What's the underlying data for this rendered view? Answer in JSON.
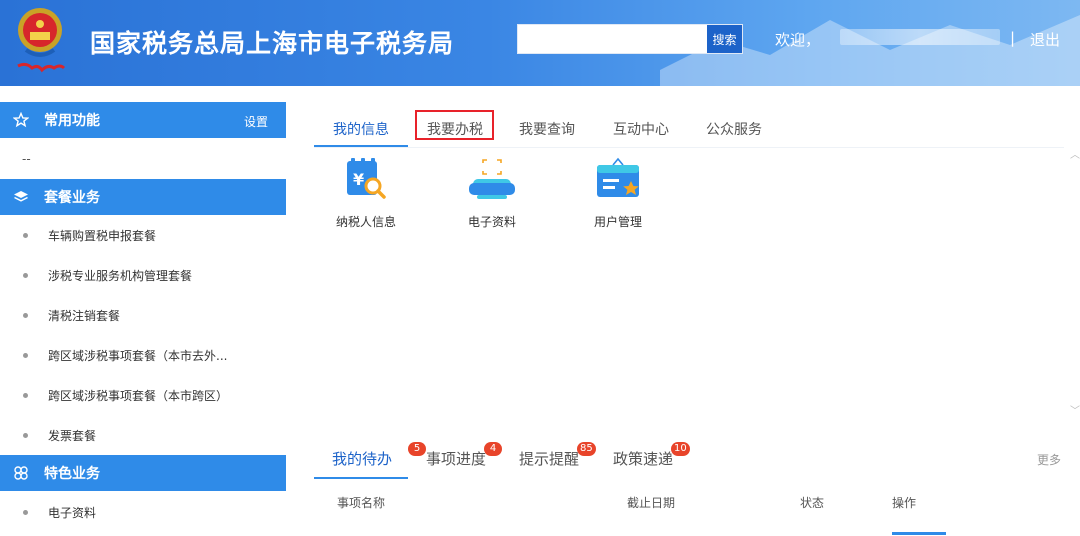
{
  "header": {
    "title": "国家税务总局上海市电子税务局",
    "search": {
      "value": "",
      "button_label": "搜索"
    },
    "welcome": "欢迎，",
    "separator": "|",
    "logout": "退出"
  },
  "sidebar": {
    "sections": [
      {
        "title": "常用功能",
        "icon": "star-icon",
        "action": "设置",
        "items": [],
        "placeholder": "--"
      },
      {
        "title": "套餐业务",
        "icon": "layers-icon",
        "items": [
          "车辆购置税申报套餐",
          "涉税专业服务机构管理套餐",
          "清税注销套餐",
          "跨区域涉税事项套餐（本市去外...",
          "跨区域涉税事项套餐（本市跨区）",
          "发票套餐"
        ]
      },
      {
        "title": "特色业务",
        "icon": "grid-flower-icon",
        "items": [
          "电子资料"
        ]
      }
    ]
  },
  "main": {
    "tabs": [
      "我的信息",
      "我要办税",
      "我要查询",
      "互动中心",
      "公众服务"
    ],
    "active_tab": "我的信息",
    "highlighted_tab": "我要办税",
    "apps": [
      {
        "label": "纳税人信息",
        "icon": "taxpayer-info-icon"
      },
      {
        "label": "电子资料",
        "icon": "electronic-docs-icon"
      },
      {
        "label": "用户管理",
        "icon": "user-management-icon"
      }
    ],
    "todo_tabs": [
      {
        "label": "我的待办",
        "badge": "5"
      },
      {
        "label": "事项进度",
        "badge": "4"
      },
      {
        "label": "提示提醒",
        "badge": "85"
      },
      {
        "label": "政策速递",
        "badge": "10"
      }
    ],
    "more": "更多",
    "table_columns": [
      "事项名称",
      "截止日期",
      "状态",
      "操作"
    ]
  },
  "colors": {
    "header_blue": "#2a72d6",
    "accent": "#2f8be8",
    "highlight_border": "#e8222a",
    "badge": "#e8442a"
  }
}
